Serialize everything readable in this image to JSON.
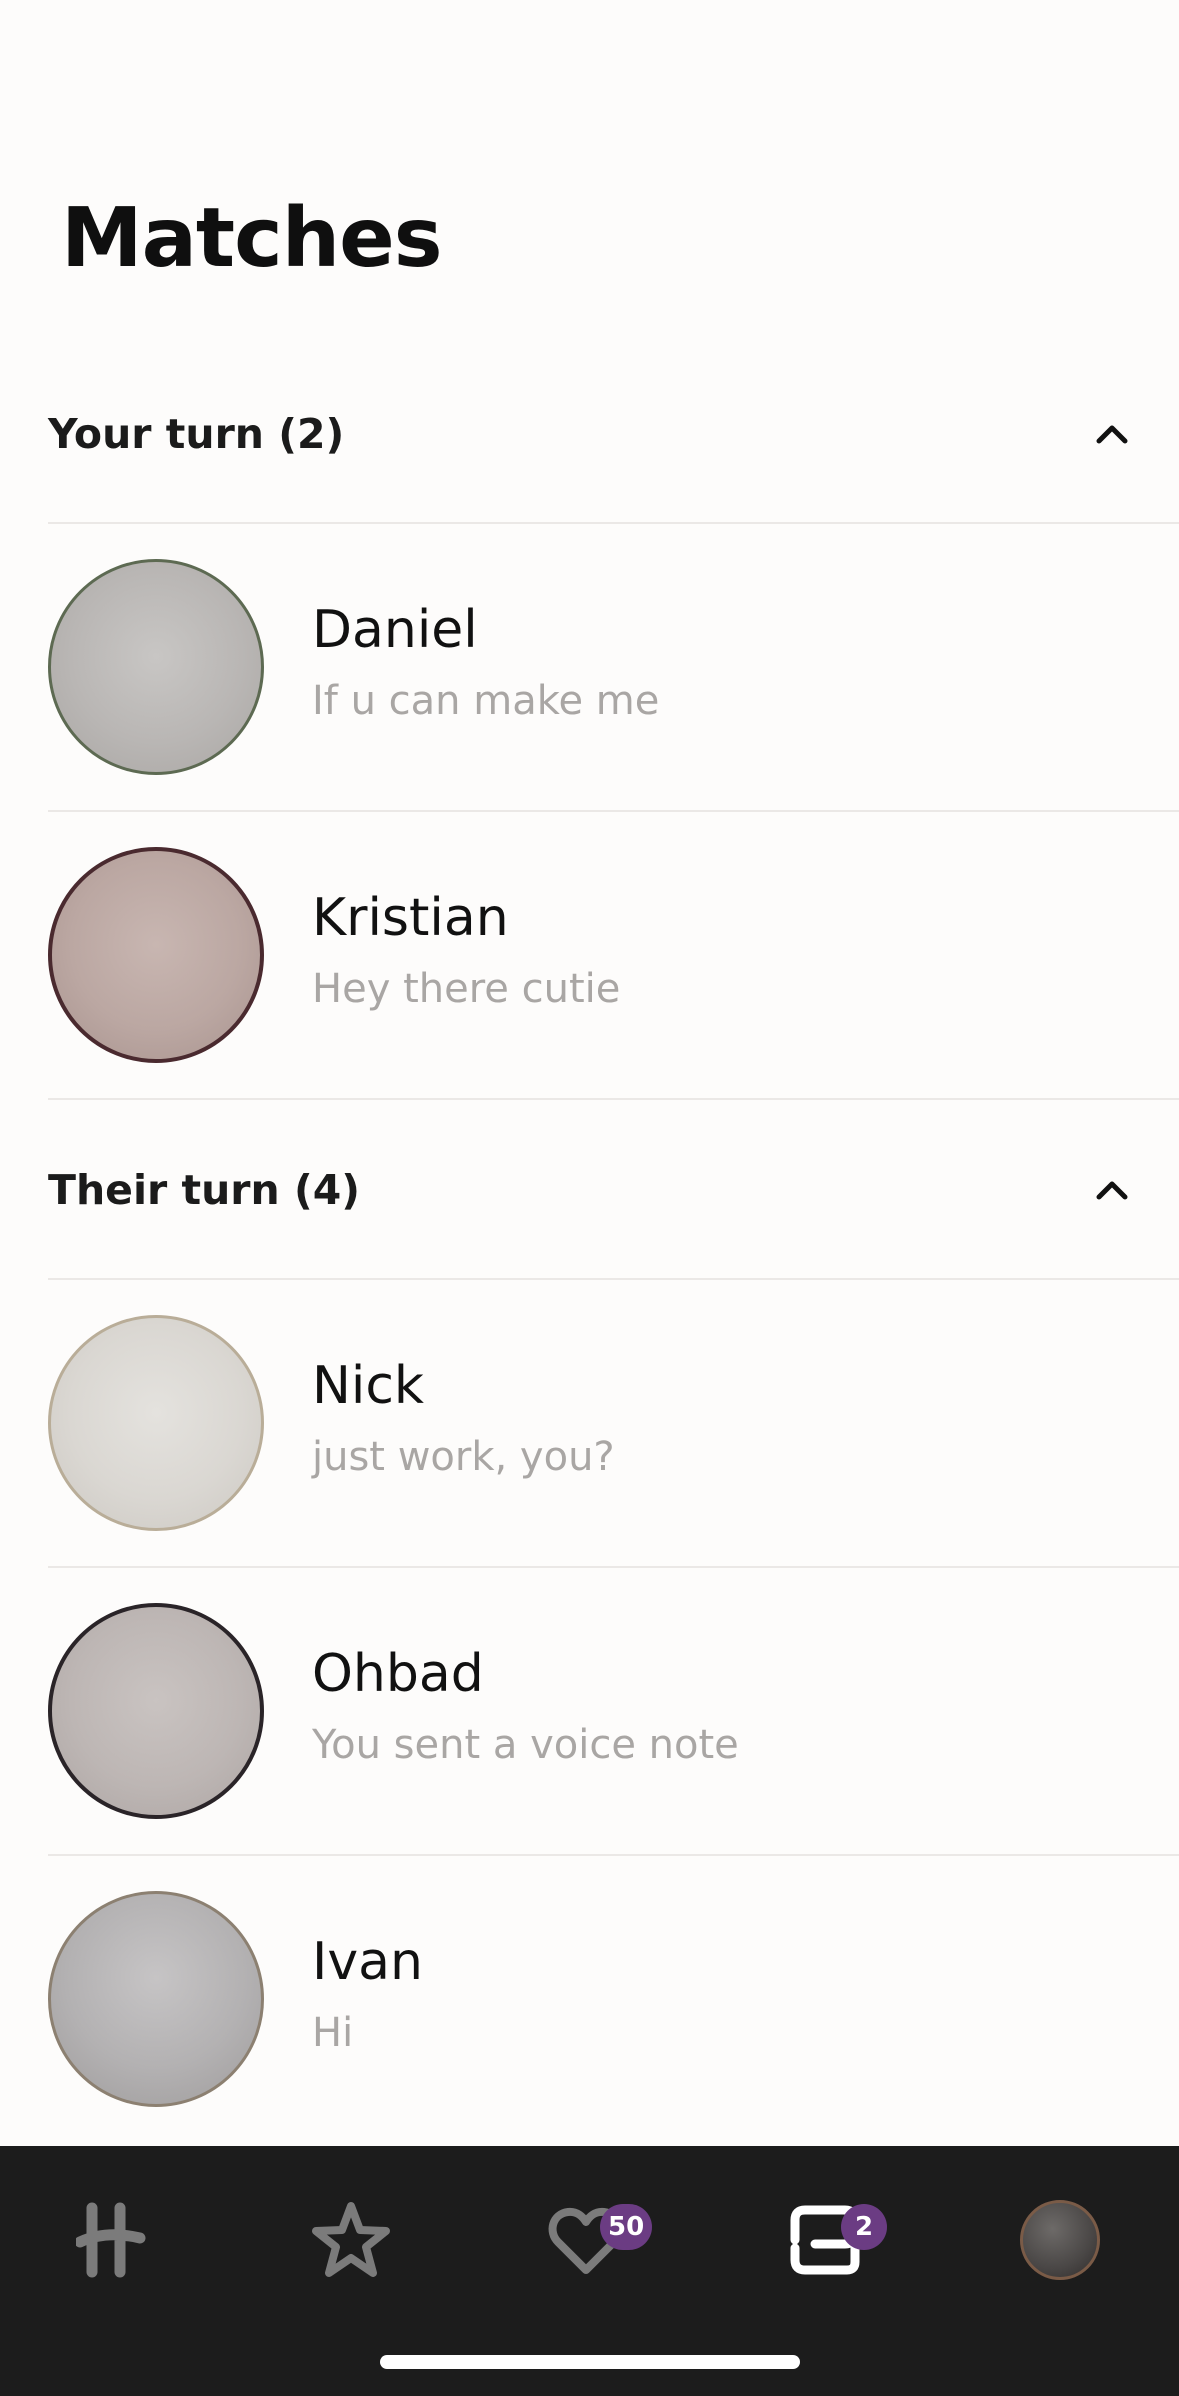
{
  "page": {
    "title": "Matches"
  },
  "sections": [
    {
      "label": "Your turn (2)",
      "matches": [
        {
          "name": "Daniel",
          "preview": "If u can make me"
        },
        {
          "name": "Kristian",
          "preview": "Hey there cutie"
        }
      ]
    },
    {
      "label": "Their turn (4)",
      "matches": [
        {
          "name": "Nick",
          "preview": "just work, you?"
        },
        {
          "name": "Ohbad",
          "preview": "You sent a voice note"
        },
        {
          "name": "Ivan",
          "preview": "Hi"
        }
      ]
    }
  ],
  "tab_bar": {
    "tabs": [
      {
        "icon": "hinge-logo-icon",
        "active": false
      },
      {
        "icon": "star-icon",
        "active": false
      },
      {
        "icon": "heart-icon",
        "badge": "50",
        "active": false
      },
      {
        "icon": "chat-bubbles-icon",
        "badge": "2",
        "active": true
      },
      {
        "icon": "profile-avatar",
        "active": false
      }
    ]
  },
  "colors": {
    "background": "#fdfcfb",
    "tab_bar": "#1c1c1c",
    "badge": "#6b3c83",
    "preview_text": "#a9a6a4"
  }
}
